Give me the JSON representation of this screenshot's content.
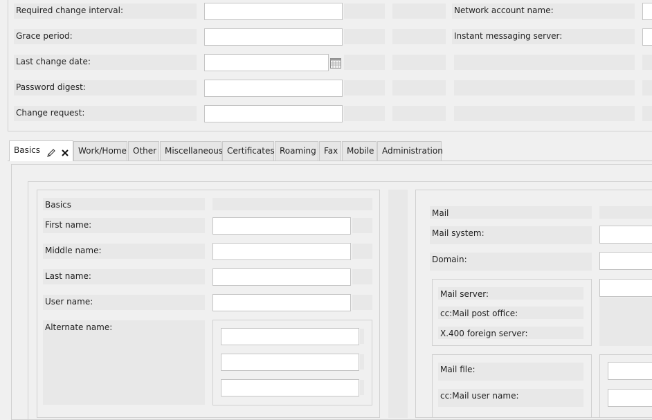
{
  "top_panel": {
    "rows": [
      {
        "label": "Required change interval:"
      },
      {
        "label": "Grace period:"
      },
      {
        "label": "Last change date:"
      },
      {
        "label": "Password digest:"
      },
      {
        "label": "Change request:"
      }
    ],
    "right_rows": [
      {
        "label": "Network account name:"
      },
      {
        "label": "Instant messaging server:"
      }
    ]
  },
  "tabs": [
    {
      "label": "Basics",
      "active": true
    },
    {
      "label": "Work/Home"
    },
    {
      "label": "Other"
    },
    {
      "label": "Miscellaneous"
    },
    {
      "label": "Certificates"
    },
    {
      "label": "Roaming"
    },
    {
      "label": "Fax"
    },
    {
      "label": "Mobile"
    },
    {
      "label": "Administration"
    }
  ],
  "basics": {
    "section_title": "Basics",
    "first_name_label": "First name:",
    "middle_name_label": "Middle name:",
    "last_name_label": "Last name:",
    "user_name_label": "User name:",
    "alternate_name_label": "Alternate name:"
  },
  "mail": {
    "section_title": "Mail",
    "mail_system_label": "Mail system:",
    "domain_label": "Domain:",
    "mail_server_label": "Mail server:",
    "ccmail_post_office_label": "cc:Mail post office:",
    "x400_server_label": "X.400 foreign server:",
    "mail_file_label": "Mail file:",
    "ccmail_user_name_label": "cc:Mail user name:"
  }
}
